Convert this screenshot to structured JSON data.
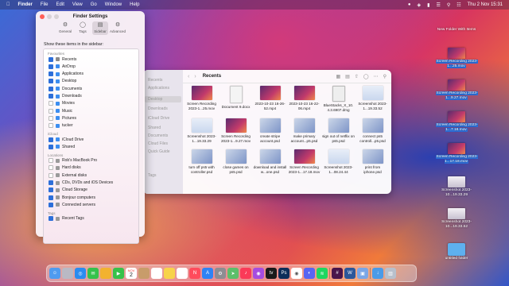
{
  "menubar": {
    "app": "Finder",
    "menus": [
      "File",
      "Edit",
      "View",
      "Go",
      "Window",
      "Help"
    ],
    "clock": "Thu 2 Nov  15:31"
  },
  "settings": {
    "title": "Finder Settings",
    "tabs": [
      {
        "label": "General",
        "icon": "gear-icon"
      },
      {
        "label": "Tags",
        "icon": "tag-icon"
      },
      {
        "label": "Sidebar",
        "icon": "sidebar-icon"
      },
      {
        "label": "Advanced",
        "icon": "gears-icon"
      }
    ],
    "active_tab": "Sidebar",
    "instruction": "Show these items in the sidebar:",
    "sections": {
      "favourites": "Favourites",
      "icloud": "iCloud",
      "locations": "Locations",
      "tags": "Tags"
    },
    "favourites": [
      {
        "label": "Recents",
        "checked": true
      },
      {
        "label": "AirDrop",
        "checked": true
      },
      {
        "label": "Applications",
        "checked": true
      },
      {
        "label": "Desktop",
        "checked": true
      },
      {
        "label": "Documents",
        "checked": true
      },
      {
        "label": "Downloads",
        "checked": true
      },
      {
        "label": "Movies",
        "checked": false
      },
      {
        "label": "Music",
        "checked": false
      },
      {
        "label": "Pictures",
        "checked": false
      },
      {
        "label": "tucker",
        "checked": false
      }
    ],
    "icloud": [
      {
        "label": "iCloud Drive",
        "checked": true
      },
      {
        "label": "Shared",
        "checked": true
      }
    ],
    "locations": [
      {
        "label": "Rob's MacBook Pro",
        "checked": false
      },
      {
        "label": "Hard disks",
        "checked": false
      },
      {
        "label": "External disks",
        "checked": false
      },
      {
        "label": "CDs, DVDs and iOS Devices",
        "checked": true
      },
      {
        "label": "Cloud Storage",
        "checked": true
      },
      {
        "label": "Bonjour computers",
        "checked": true
      },
      {
        "label": "Connected servers",
        "checked": true
      }
    ],
    "tags": [
      {
        "label": "Recent Tags",
        "checked": true
      }
    ]
  },
  "finder": {
    "title": "Recents",
    "sidebar_hints": [
      "Recents",
      "Applications",
      "Desktop",
      "Downloads",
      "iCloud Drive",
      "Shared",
      "Documents",
      "Cloud Files",
      "Quick Guide",
      "Tags"
    ],
    "files": [
      {
        "name": "Screen Recording 2023-1...25.mov",
        "kind": "vid"
      },
      {
        "name": "Document 9.docx",
        "kind": "doc"
      },
      {
        "name": "2023-10-23 16-26-52.mp4",
        "kind": "vid"
      },
      {
        "name": "2023-10-23 16-22-06.mp4",
        "kind": "vid"
      },
      {
        "name": "BlueStacks_X_10. 4.3.6907.dmg",
        "kind": "dmg"
      },
      {
        "name": "Screenshot 2023-1...19.33.52",
        "kind": "shot"
      },
      {
        "name": "Screenshot 2023-1...19.33.29",
        "kind": "shot"
      },
      {
        "name": "Screen Recording 2023-1...9.27.mov",
        "kind": "vid"
      },
      {
        "name": "create stripe account.psd",
        "kind": "psd"
      },
      {
        "name": "make primary account...p5.psd",
        "kind": "psd"
      },
      {
        "name": "sign out of netflix on ps5.psd",
        "kind": "psd"
      },
      {
        "name": "connect ps5 controll...p5.psd",
        "kind": "psd"
      },
      {
        "name": "turn off ps5 with controller.psd",
        "kind": "psd"
      },
      {
        "name": "close games on ps5.psd",
        "kind": "psd"
      },
      {
        "name": "download and install w...one.psd",
        "kind": "psd"
      },
      {
        "name": "Screen Recording 2023-1...17.18.mov",
        "kind": "vid"
      },
      {
        "name": "Screenshot 2023-1...08.24.44",
        "kind": "shot"
      },
      {
        "name": "print from iphone.psd",
        "kind": "psd"
      }
    ]
  },
  "desktop": [
    {
      "name": "New Folder With Items",
      "kind": "folder"
    },
    {
      "name": "Screen Recording 2023-1...25.mov",
      "kind": "vid"
    },
    {
      "name": "Screen Recording 2023-1...9.27.mov",
      "kind": "vid"
    },
    {
      "name": "Screen Recording 2023-1...7.18.mov",
      "kind": "vid"
    },
    {
      "name": "Screen Recording 2023-1...17.18.mov",
      "kind": "vid"
    },
    {
      "name": "Screenshot 2023-10...19.33.29",
      "kind": "shot"
    },
    {
      "name": "Screenshot 2023-10...19.33.52",
      "kind": "shot"
    },
    {
      "name": "untitled folder",
      "kind": "folder"
    }
  ],
  "dock": [
    "finder",
    "launchpad",
    "safari",
    "messages",
    "photos",
    "facetime",
    "calendar",
    "contacts",
    "reminders",
    "notes",
    "freeform",
    "news",
    "appstore",
    "settings",
    "maps",
    "music",
    "podcasts",
    "tv",
    "photoshop",
    "chrome",
    "discord",
    "spotify",
    "slack",
    "word",
    "preview",
    "downloads",
    "trash"
  ],
  "dock_calendar": {
    "month": "NOV",
    "day": "2"
  }
}
